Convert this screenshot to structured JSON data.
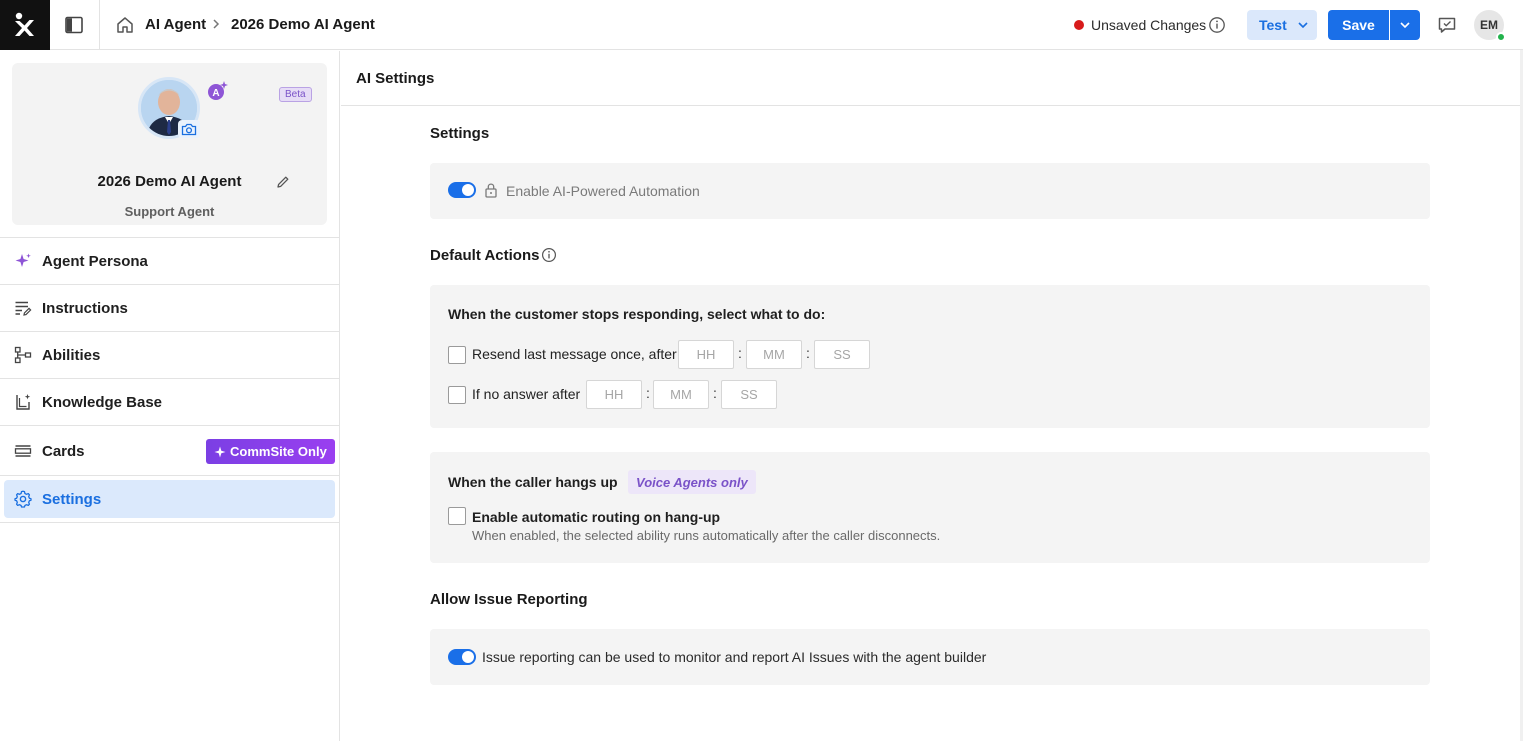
{
  "header": {
    "breadcrumb_1": "AI Agent",
    "breadcrumb_2": "2026 Demo AI Agent",
    "status_text": "Unsaved Changes",
    "test_label": "Test",
    "save_label": "Save",
    "user_initials": "EM",
    "colors": {
      "accent": "#1a6fe8",
      "unsaved": "#d81b1b",
      "online": "#22b24c"
    }
  },
  "agent": {
    "name": "2026 Demo AI Agent",
    "role": "Support Agent",
    "beta_label": "Beta"
  },
  "sidebar": {
    "items": [
      {
        "label": "Agent Persona",
        "icon": "sparkle-icon"
      },
      {
        "label": "Instructions",
        "icon": "list-edit-icon"
      },
      {
        "label": "Abilities",
        "icon": "flow-icon"
      },
      {
        "label": "Knowledge Base",
        "icon": "knowledge-icon"
      },
      {
        "label": "Cards",
        "icon": "cards-icon",
        "badge": "CommSite Only"
      },
      {
        "label": "Settings",
        "icon": "gear-icon",
        "active": true
      }
    ]
  },
  "main": {
    "title": "AI Settings",
    "settings_heading": "Settings",
    "ai_automation_label": "Enable AI-Powered Automation",
    "ai_automation_on": true,
    "default_actions_heading": "Default Actions",
    "stops_responding_prompt": "When the customer stops responding, select what to do:",
    "resend_label": "Resend last message once, after",
    "no_answer_label": "If no answer after",
    "time_placeholders": {
      "hh": "HH",
      "mm": "MM",
      "ss": "SS"
    },
    "time_separator": ":",
    "hangup_title": "When the caller hangs up",
    "voice_badge": "Voice Agents only",
    "routing_label": "Enable automatic routing on hang-up",
    "routing_desc": "When enabled, the selected ability runs automatically after the caller disconnects.",
    "issue_heading": "Allow Issue Reporting",
    "issue_label": "Issue reporting can be used to monitor and report AI Issues with the agent builder",
    "issue_on": true
  }
}
